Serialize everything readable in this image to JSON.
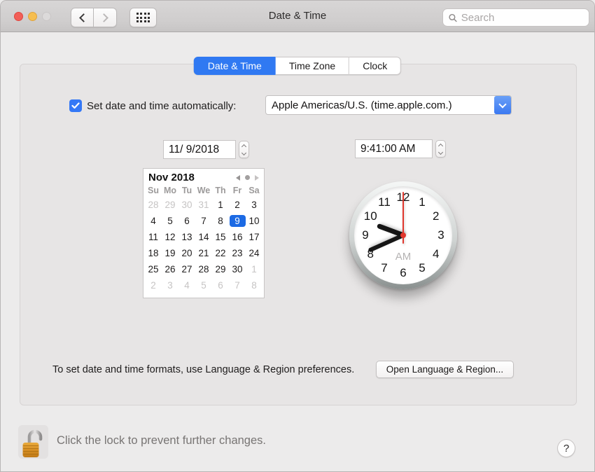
{
  "window": {
    "title": "Date & Time"
  },
  "toolbar": {
    "search_placeholder": "Search",
    "icons": {
      "back": "chevron-left",
      "forward": "chevron-right",
      "show_all": "grid-of-dots",
      "search": "magnifier"
    }
  },
  "tabs": [
    {
      "label": "Date & Time",
      "selected": true
    },
    {
      "label": "Time Zone",
      "selected": false
    },
    {
      "label": "Clock",
      "selected": false
    }
  ],
  "auto_set": {
    "checked": true,
    "label": "Set date and time automatically:",
    "server": "Apple Americas/U.S. (time.apple.com.)"
  },
  "date_field": {
    "value": "11/ 9/2018"
  },
  "time_field": {
    "value": "9:41:00 AM"
  },
  "calendar": {
    "month_label": "Nov 2018",
    "weekdays": [
      "Su",
      "Mo",
      "Tu",
      "We",
      "Th",
      "Fr",
      "Sa"
    ],
    "selected_day": 9,
    "cells": [
      {
        "v": "28",
        "muted": true
      },
      {
        "v": "29",
        "muted": true
      },
      {
        "v": "30",
        "muted": true
      },
      {
        "v": "31",
        "muted": true
      },
      {
        "v": "1"
      },
      {
        "v": "2"
      },
      {
        "v": "3"
      },
      {
        "v": "4"
      },
      {
        "v": "5"
      },
      {
        "v": "6"
      },
      {
        "v": "7"
      },
      {
        "v": "8"
      },
      {
        "v": "9",
        "selected": true
      },
      {
        "v": "10"
      },
      {
        "v": "11"
      },
      {
        "v": "12"
      },
      {
        "v": "13"
      },
      {
        "v": "14"
      },
      {
        "v": "15"
      },
      {
        "v": "16"
      },
      {
        "v": "17"
      },
      {
        "v": "18"
      },
      {
        "v": "19"
      },
      {
        "v": "20"
      },
      {
        "v": "21"
      },
      {
        "v": "22"
      },
      {
        "v": "23"
      },
      {
        "v": "24"
      },
      {
        "v": "25"
      },
      {
        "v": "26"
      },
      {
        "v": "27"
      },
      {
        "v": "28"
      },
      {
        "v": "29"
      },
      {
        "v": "30"
      },
      {
        "v": "1",
        "muted": true
      },
      {
        "v": "2",
        "muted": true
      },
      {
        "v": "3",
        "muted": true
      },
      {
        "v": "4",
        "muted": true
      },
      {
        "v": "5",
        "muted": true
      },
      {
        "v": "6",
        "muted": true
      },
      {
        "v": "7",
        "muted": true
      },
      {
        "v": "8",
        "muted": true
      }
    ]
  },
  "clock": {
    "hour": 9,
    "minute": 41,
    "second": 0,
    "period_label": "AM",
    "numbers": [
      "1",
      "2",
      "3",
      "4",
      "5",
      "6",
      "7",
      "8",
      "9",
      "10",
      "11",
      "12"
    ]
  },
  "footer": {
    "note": "To set date and time formats, use Language & Region preferences.",
    "button_label": "Open Language & Region..."
  },
  "bottom_bar": {
    "lock_icon": "open-padlock",
    "lock_text": "Click the lock to prevent further changes.",
    "help_label": "?"
  },
  "colors": {
    "accent": "#3478f6",
    "tab_selected": "#3079f2",
    "selected_day_bg": "#1c6ae4",
    "second_hand": "#e0372d"
  }
}
